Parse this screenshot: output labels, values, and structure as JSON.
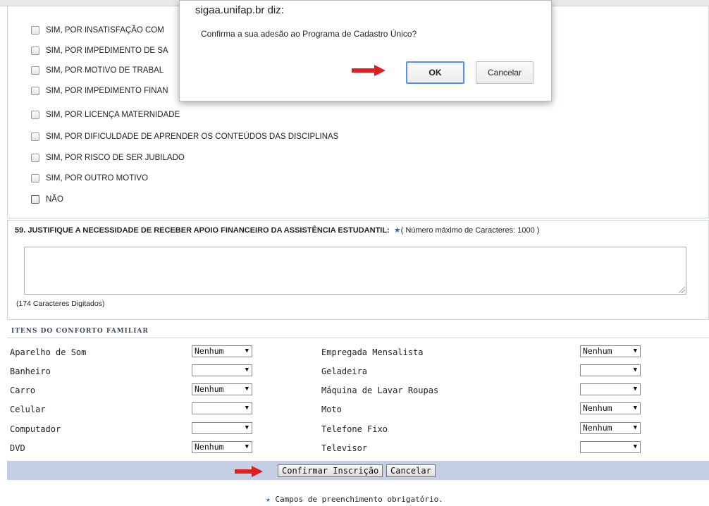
{
  "options": [
    {
      "label": "SIM, POR INSATISFAÇÃO COM"
    },
    {
      "label": "SIM, POR IMPEDIMENTO DE SA"
    },
    {
      "label": "SIM, POR MOTIVO DE TRABAL"
    },
    {
      "label": "SIM, POR IMPEDIMENTO FINAN"
    },
    {
      "label": "SIM, POR LICENÇA MATERNIDADE"
    },
    {
      "label": "SIM, POR DIFICULDADE DE APRENDER OS CONTEÚDOS DAS DISCIPLINAS"
    },
    {
      "label": "SIM, POR RISCO DE SER JUBILADO"
    },
    {
      "label": "SIM, POR OUTRO MOTIVO"
    },
    {
      "label": "NÃO"
    }
  ],
  "question": {
    "title": "59. JUSTIFIQUE A NECESSIDADE DE RECEBER APOIO FINANCEIRO DA ASSISTÊNCIA ESTUDANTIL:",
    "star": "★",
    "max_note": "( Número máximo de Caracteres: 1000 )",
    "counter": "(174 Caracteres Digitados)"
  },
  "comfort": {
    "title": "Itens do conforto familiar",
    "rows": [
      {
        "left_label": "Aparelho de Som",
        "left_value": "Nenhum",
        "right_label": "Empregada Mensalista",
        "right_value": "Nenhum"
      },
      {
        "left_label": "Banheiro",
        "left_value": "",
        "right_label": "Geladeira",
        "right_value": ""
      },
      {
        "left_label": "Carro",
        "left_value": "Nenhum",
        "right_label": "Máquina de Lavar Roupas",
        "right_value": ""
      },
      {
        "left_label": "Celular",
        "left_value": "",
        "right_label": "Moto",
        "right_value": "Nenhum"
      },
      {
        "left_label": "Computador",
        "left_value": "",
        "right_label": "Telefone Fixo",
        "right_value": "Nenhum"
      },
      {
        "left_label": "DVD",
        "left_value": "Nenhum",
        "right_label": "Televisor",
        "right_value": ""
      }
    ]
  },
  "buttons": {
    "confirm": "Confirmar Inscrição",
    "cancel": "Cancelar"
  },
  "note": {
    "star": "★",
    "text": "Campos de preenchimento obrigatório."
  },
  "dialog": {
    "title": "sigaa.unifap.br diz:",
    "message": "Confirma a sua adesão ao Programa de Cadastro Único?",
    "ok": "OK",
    "cancel": "Cancelar"
  },
  "colors": {
    "accent": "#3a66c4",
    "arrow": "#e01e1e",
    "button_bar": "#c4cfe4"
  },
  "icons": {
    "dropdown": "▼",
    "annotation": "red-arrow-icon"
  }
}
